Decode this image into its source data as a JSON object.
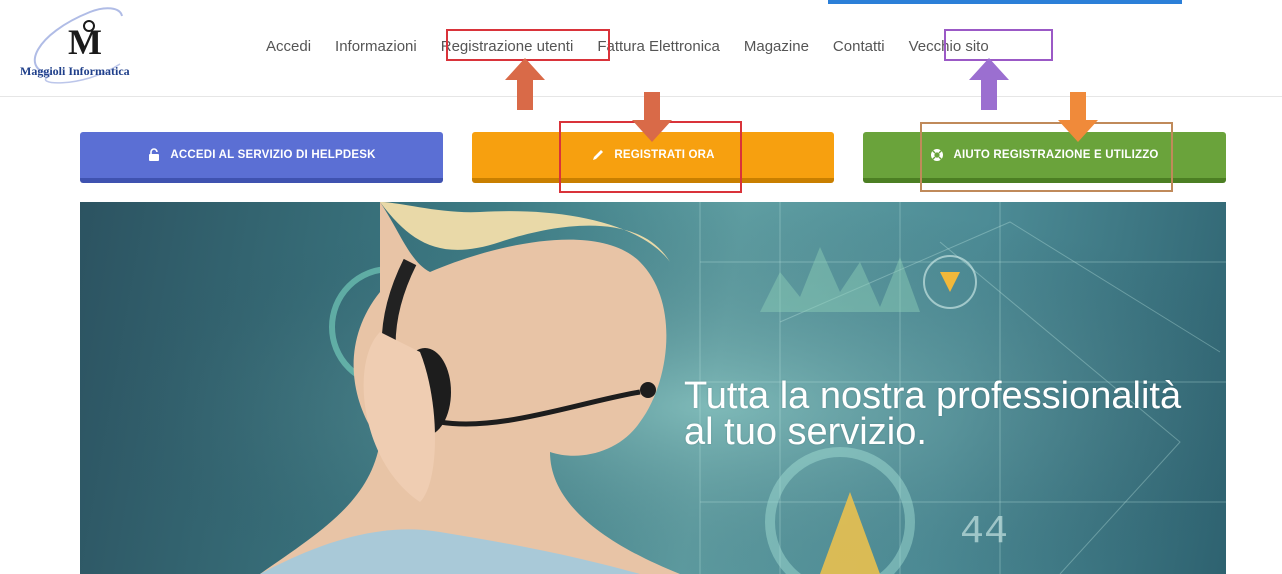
{
  "header": {
    "logo_text": "Maggioli Informatica",
    "nav": [
      {
        "label": "Accedi"
      },
      {
        "label": "Informazioni"
      },
      {
        "label": "Registrazione utenti"
      },
      {
        "label": "Fattura Elettronica"
      },
      {
        "label": "Magazine"
      },
      {
        "label": "Contatti"
      },
      {
        "label": "Vecchio sito"
      }
    ]
  },
  "actions": {
    "helpdesk": {
      "label": "ACCEDI AL SERVIZIO DI HELPDESK",
      "icon": "unlock-icon"
    },
    "register": {
      "label": "REGISTRATI ORA",
      "icon": "pencil-icon"
    },
    "help": {
      "label": "AIUTO REGISTRAZIONE E UTILIZZO",
      "icon": "lifebuoy-icon"
    }
  },
  "hero": {
    "line1": "Tutta la nostra professionalità",
    "line2": "al tuo servizio."
  },
  "colors": {
    "helpdesk": "#5b6fd4",
    "register": "#f7a00f",
    "help": "#6aa33b",
    "annot_red": "#d9333a",
    "annot_purple": "#9b59c6",
    "annot_orange_arrow": "#d96a48",
    "annot_brown": "#c08a5a",
    "annot_purple_arrow": "#9b6fd0",
    "annot_orange2_arrow": "#f08a3a"
  }
}
